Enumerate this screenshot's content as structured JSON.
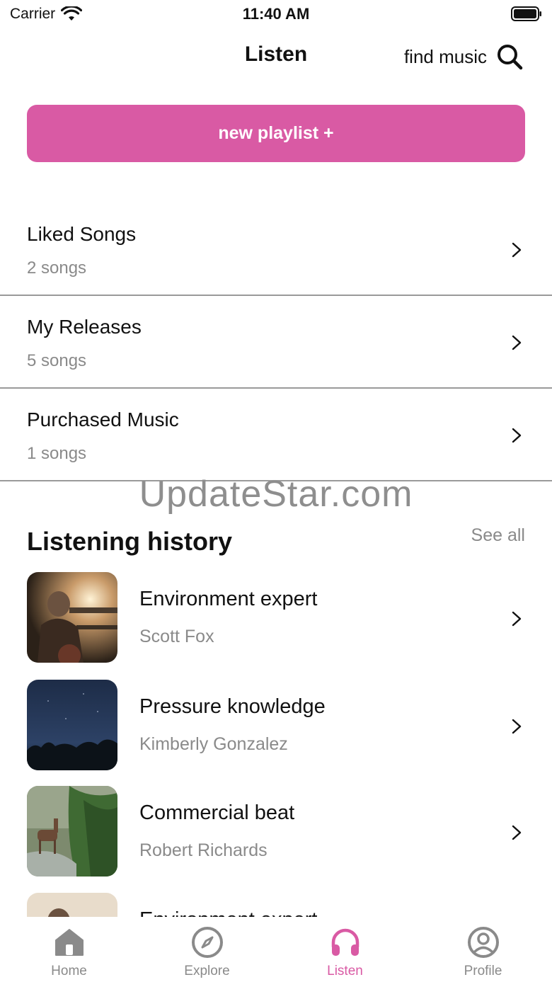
{
  "status_bar": {
    "carrier": "Carrier",
    "time": "11:40 AM"
  },
  "header": {
    "title": "Listen",
    "find_music": "find music"
  },
  "primary_button": {
    "label": "new playlist +"
  },
  "library": [
    {
      "title": "Liked Songs",
      "subtitle": "2 songs"
    },
    {
      "title": "My Releases",
      "subtitle": "5 songs"
    },
    {
      "title": "Purchased Music",
      "subtitle": "1 songs"
    }
  ],
  "watermark": "UpdateStar.com",
  "history": {
    "title": "Listening history",
    "see_all": "See all",
    "items": [
      {
        "title": "Environment expert",
        "artist": "Scott Fox"
      },
      {
        "title": "Pressure knowledge",
        "artist": "Kimberly Gonzalez"
      },
      {
        "title": "Commercial beat",
        "artist": "Robert Richards"
      },
      {
        "title": "Environment expert",
        "artist": ""
      }
    ]
  },
  "tabs": [
    {
      "label": "Home",
      "icon": "home-icon",
      "active": false
    },
    {
      "label": "Explore",
      "icon": "compass-icon",
      "active": false
    },
    {
      "label": "Listen",
      "icon": "headphones-icon",
      "active": true
    },
    {
      "label": "Profile",
      "icon": "profile-icon",
      "active": false
    }
  ],
  "colors": {
    "accent": "#d95aa4",
    "muted_text": "#8a8a8a",
    "divider": "#9a9a9a"
  }
}
